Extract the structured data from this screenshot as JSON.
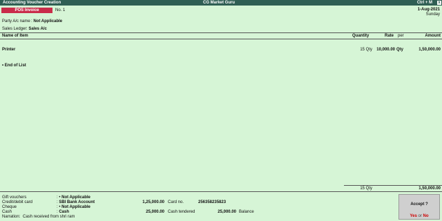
{
  "window": {
    "title": "Accounting Voucher  Creation",
    "company": "CG Market Guru",
    "shortcut": "Ctrl + M",
    "close": "x"
  },
  "voucher": {
    "type": "POS Invoice",
    "number": "No. 1",
    "date": "1-Aug-2021",
    "day": "Sunday"
  },
  "party": {
    "label": "Party A/c name",
    "value": "Not Applicable"
  },
  "sales_ledger": {
    "label": "Sales Ledger",
    "value": "Sales A/c"
  },
  "table": {
    "headers": {
      "item": "Name of Item",
      "quantity": "Quantity",
      "rate": "Rate",
      "per": "per",
      "amount": "Amount"
    },
    "rows": [
      {
        "item": "Printer",
        "quantity": "15 Qty",
        "rate": "10,000.00",
        "per": "Qty",
        "amount": "1,50,000.00"
      }
    ],
    "end_of_list": "End of List",
    "total_quantity": "15 Qty",
    "total_amount": "1,50,000.00"
  },
  "payments": {
    "gift_vouchers": {
      "label": "Gift vouchers",
      "value": "Not Applicable"
    },
    "credit_debit_card": {
      "label": "Credit/debit card",
      "value": "SBI Bank Account",
      "amount": "1,25,000.00",
      "card_no_label": "Card no.",
      "card_no": "256358235823"
    },
    "cheque": {
      "label": "Cheque",
      "value": "Not Applicable"
    },
    "cash": {
      "label": "Cash",
      "value": "Cash",
      "amount": "25,000.00",
      "tendered_label": "Cash tendered",
      "tendered_amount": "25,000.00",
      "balance_label": "Balance"
    },
    "narration": {
      "label": "Narration:",
      "value": "Cash received from shri ram"
    }
  },
  "accept_dialog": {
    "question": "Accept ?",
    "yes": "Yes",
    "or": "or",
    "no": "No"
  }
}
